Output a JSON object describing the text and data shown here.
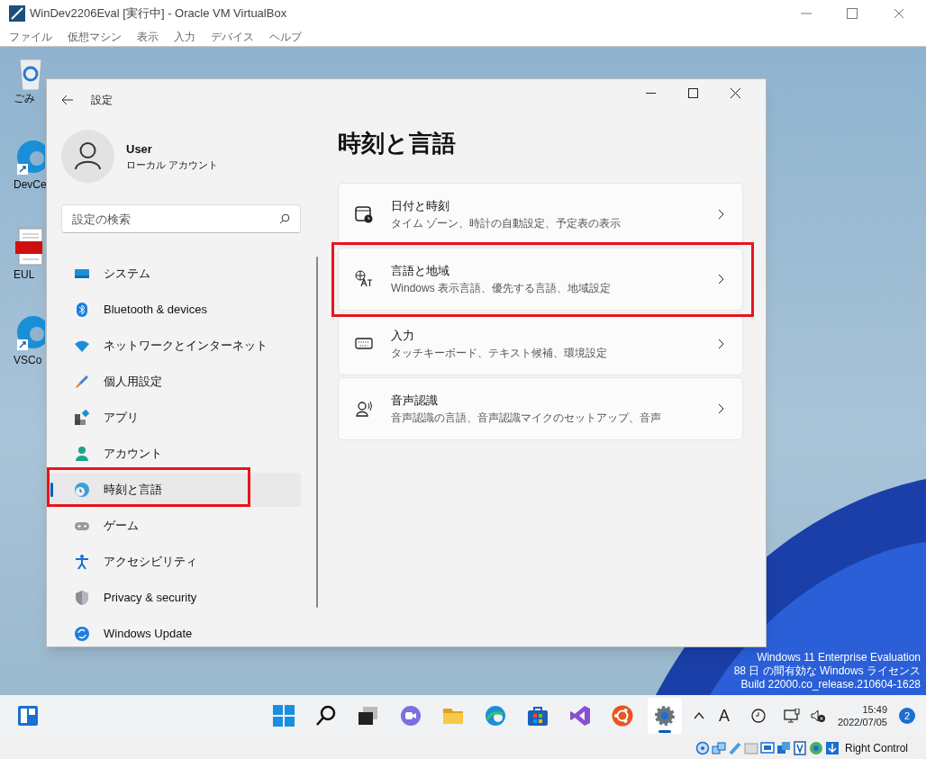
{
  "window": {
    "title": "WinDev2206Eval [実行中] - Oracle VM VirtualBox"
  },
  "menu": [
    "ファイル",
    "仮想マシン",
    "表示",
    "入力",
    "デバイス",
    "ヘルプ"
  ],
  "desktop_icons": [
    {
      "kind": "recycle",
      "label": "ごみ"
    },
    {
      "kind": "edge",
      "label": "DevCe"
    },
    {
      "kind": "pdf",
      "label": "EUL"
    },
    {
      "kind": "edge",
      "label": "VSCo"
    }
  ],
  "settings": {
    "title": "設定",
    "user": {
      "name": "User",
      "account": "ローカル アカウント"
    },
    "search": {
      "placeholder": "設定の検索"
    },
    "nav": [
      {
        "kind": "system",
        "label": "システム",
        "selected": false,
        "highlighted": false
      },
      {
        "kind": "bluetooth",
        "label": "Bluetooth & devices",
        "selected": false,
        "highlighted": false
      },
      {
        "kind": "network",
        "label": "ネットワークとインターネット",
        "selected": false,
        "highlighted": false
      },
      {
        "kind": "personalize",
        "label": "個人用設定",
        "selected": false,
        "highlighted": false
      },
      {
        "kind": "apps",
        "label": "アプリ",
        "selected": false,
        "highlighted": false
      },
      {
        "kind": "account",
        "label": "アカウント",
        "selected": false,
        "highlighted": false
      },
      {
        "kind": "time",
        "label": "時刻と言語",
        "selected": true,
        "highlighted": true
      },
      {
        "kind": "game",
        "label": "ゲーム",
        "selected": false,
        "highlighted": false
      },
      {
        "kind": "accessibility",
        "label": "アクセシビリティ",
        "selected": false,
        "highlighted": false
      },
      {
        "kind": "privacy",
        "label": "Privacy & security",
        "selected": false,
        "highlighted": false
      },
      {
        "kind": "update",
        "label": "Windows Update",
        "selected": false,
        "highlighted": false
      }
    ],
    "heading": "時刻と言語",
    "cards": [
      {
        "kind": "calendar",
        "title": "日付と時刻",
        "subtitle": "タイム ゾーン、時計の自動設定、予定表の表示",
        "highlighted": false
      },
      {
        "kind": "language",
        "title": "言語と地域",
        "subtitle": "Windows 表示言語、優先する言語、地域設定",
        "highlighted": true
      },
      {
        "kind": "keyboard",
        "title": "入力",
        "subtitle": "タッチキーボード、テキスト候補、環境設定",
        "highlighted": false
      },
      {
        "kind": "speech",
        "title": "音声認識",
        "subtitle": "音声認識の言語、音声認識マイクのセットアップ、音声",
        "highlighted": false
      }
    ]
  },
  "watermark_text": [
    "Windows 11 Enterprise Evaluation",
    "88 日 の間有効な Windows ライセンス",
    "Build 22000.co_release.210604-1628"
  ],
  "taskbar": {
    "apps": [
      {
        "kind": "start",
        "active": false
      },
      {
        "kind": "search",
        "active": false
      },
      {
        "kind": "taskview",
        "active": false
      },
      {
        "kind": "chat",
        "active": false
      },
      {
        "kind": "folder",
        "active": false
      },
      {
        "kind": "edge",
        "active": false
      },
      {
        "kind": "store",
        "active": false
      },
      {
        "kind": "vs",
        "active": false
      },
      {
        "kind": "ubuntu",
        "active": false
      },
      {
        "kind": "settings",
        "active": true
      }
    ],
    "ime": "A",
    "time": "15:49",
    "date": "2022/07/05",
    "notifications": "2"
  },
  "status_bar": {
    "host_key": "Right Control"
  }
}
